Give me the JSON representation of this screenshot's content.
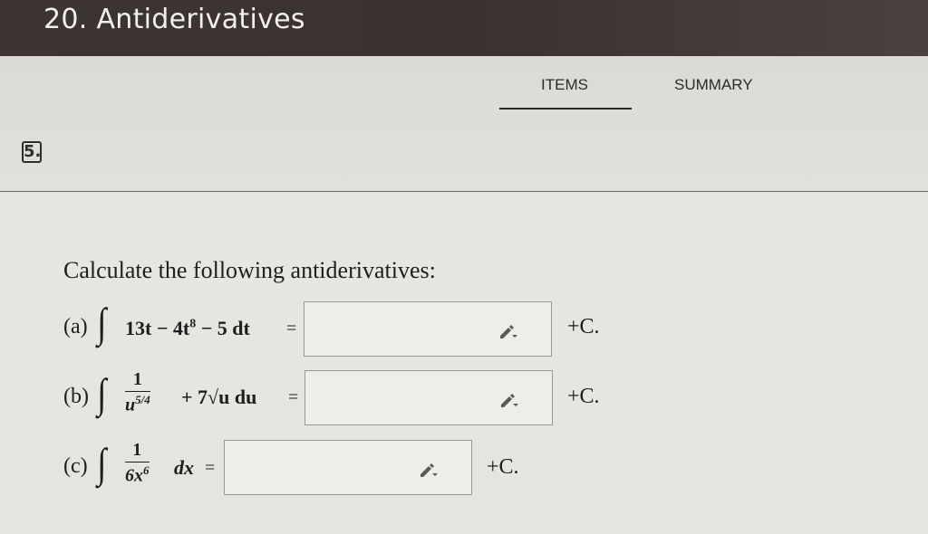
{
  "header": {
    "title": "20. Antiderivatives"
  },
  "tabs": [
    {
      "label": "ITEMS",
      "active": true
    },
    {
      "label": "SUMMARY",
      "active": false
    }
  ],
  "question": {
    "number": "5.",
    "prompt": "Calculate the following antiderivatives:",
    "parts": [
      {
        "label": "(a)",
        "integrand": "13t − 4t",
        "exp": "8",
        "rest": " − 5 dt",
        "equals": "=",
        "value": "",
        "suffix": "+C."
      },
      {
        "label": "(b)",
        "numerator": "1",
        "denominator": "u",
        "den_exp": "5/4",
        "rest": "+ 7√u du",
        "equals": "=",
        "value": "",
        "suffix": "+C."
      },
      {
        "label": "(c)",
        "numerator": "1",
        "denominator": "6x",
        "den_exp": "6",
        "rest": "dx",
        "equals": "=",
        "value": "",
        "suffix": "+C."
      }
    ]
  },
  "icons": {
    "input_icon": "pencil-dropdown-icon"
  }
}
